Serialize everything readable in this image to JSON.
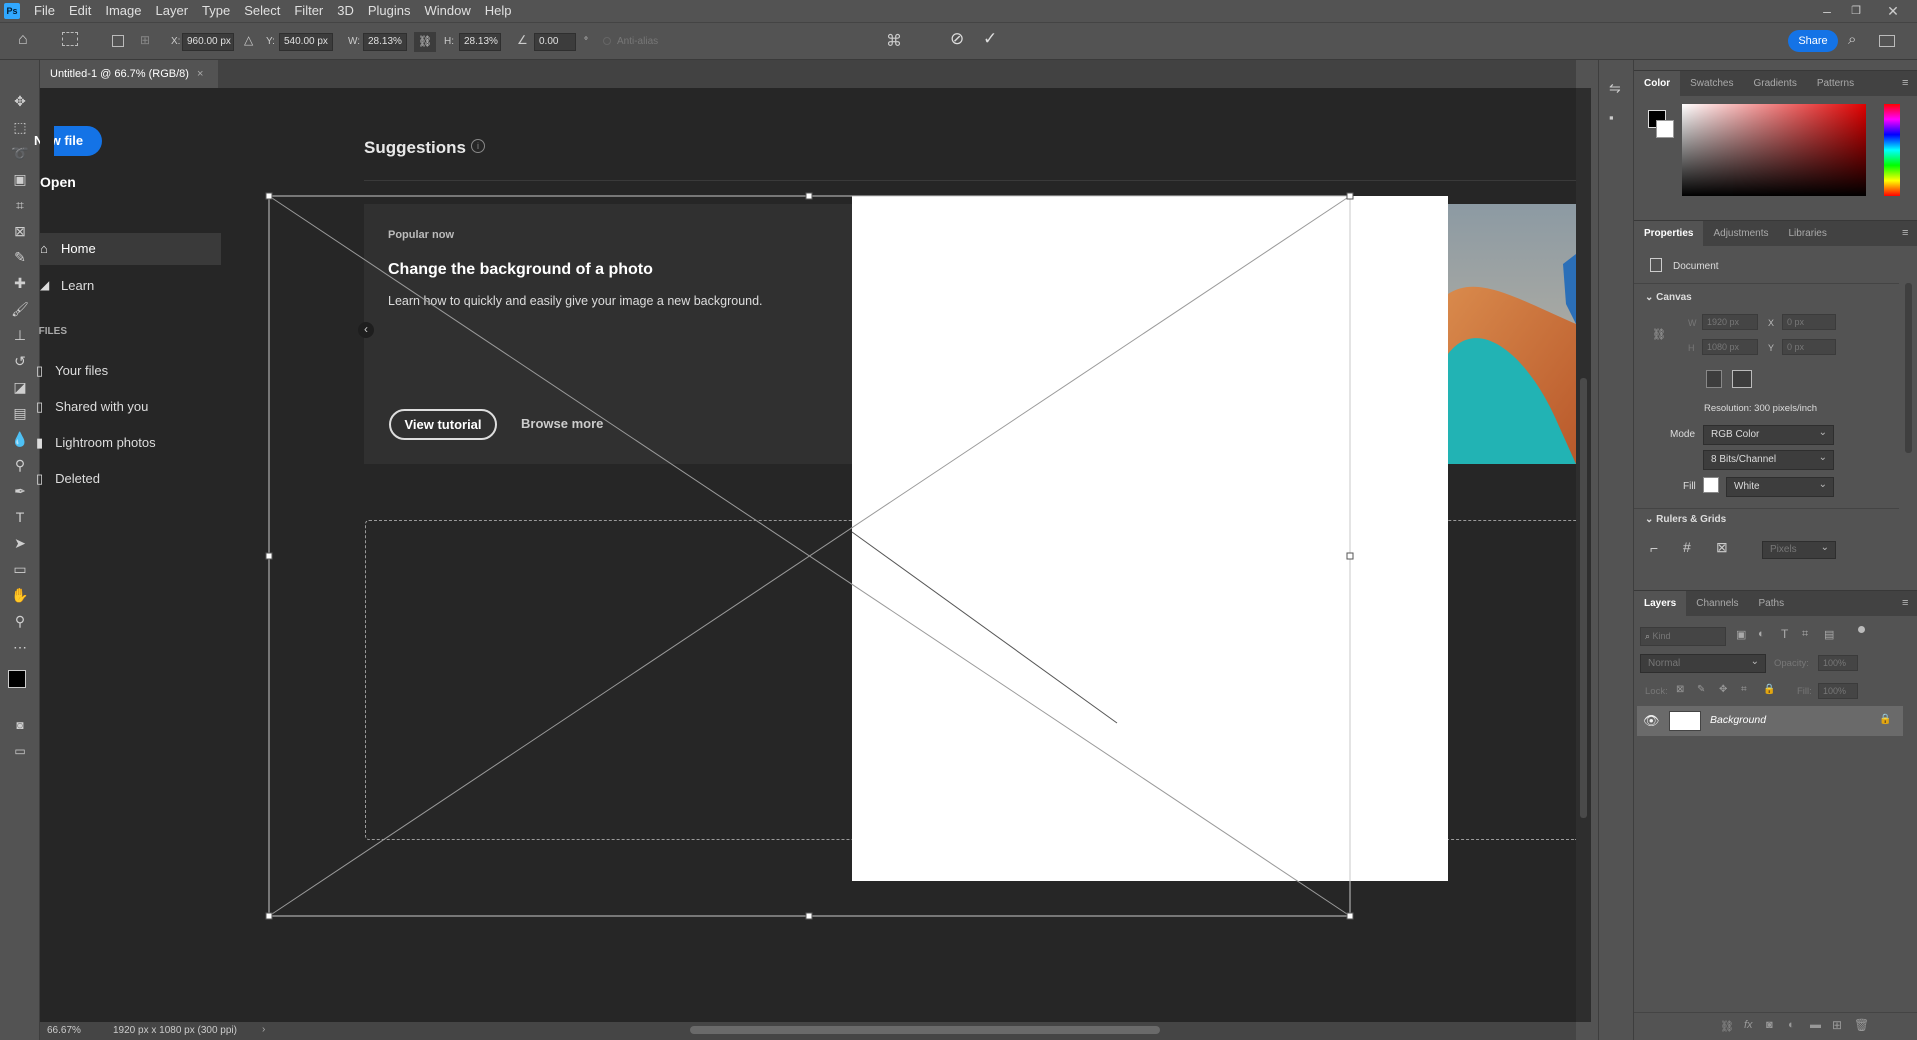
{
  "menubar": {
    "logo": "Ps",
    "items": [
      "File",
      "Edit",
      "Image",
      "Layer",
      "Type",
      "Select",
      "Filter",
      "3D",
      "Plugins",
      "Window",
      "Help"
    ]
  },
  "options": {
    "x_label": "X:",
    "x_value": "960.00 px",
    "y_label": "Y:",
    "y_value": "540.00 px",
    "w_label": "W:",
    "w_value": "28.13%",
    "h_label": "H:",
    "h_value": "28.13%",
    "angle_value": "0.00",
    "deg": "°",
    "antialias_label": "Anti-alias",
    "share_label": "Share"
  },
  "document": {
    "tab_title": "Untitled-1 @ 66.7% (RGB/8)"
  },
  "home": {
    "new_file": "New file",
    "open": "Open",
    "nav": [
      "Home",
      "Learn"
    ],
    "files_heading": "FILES",
    "files": [
      "Your files",
      "Shared with you",
      "Lightroom photos",
      "Deleted"
    ],
    "suggestions_title": "Suggestions",
    "card_eyebrow": "Popular now",
    "card_title": "Change the background of a photo",
    "card_desc": "Learn how to quickly and easily give your image a new background.",
    "view_tutorial": "View tutorial",
    "browse_more": "Browse more"
  },
  "status": {
    "zoom": "66.67%",
    "doc_info": "1920 px x 1080 px (300 ppi)"
  },
  "color_panel": {
    "tabs": [
      "Color",
      "Swatches",
      "Gradients",
      "Patterns"
    ]
  },
  "properties": {
    "tabs": [
      "Properties",
      "Adjustments",
      "Libraries"
    ],
    "doc_label": "Document",
    "canvas_section": "Canvas",
    "w_label": "W",
    "w_value": "1920 px",
    "h_label": "H",
    "h_value": "1080 px",
    "x_label": "X",
    "x_value": "0 px",
    "y_label": "Y",
    "y_value": "0 px",
    "resolution": "Resolution: 300 pixels/inch",
    "mode_label": "Mode",
    "mode_value": "RGB Color",
    "bits_value": "8 Bits/Channel",
    "fill_label": "Fill",
    "fill_value": "White",
    "rulers_section": "Rulers & Grids",
    "units_value": "Pixels"
  },
  "layers": {
    "tabs": [
      "Layers",
      "Channels",
      "Paths"
    ],
    "kind_placeholder": "Kind",
    "blend_mode": "Normal",
    "opacity_label": "Opacity:",
    "opacity_value": "100%",
    "lock_label": "Lock:",
    "fill_label": "Fill:",
    "fill_value": "100%",
    "layer_name": "Background"
  },
  "colors": {
    "accent": "#1473e6",
    "canvas_bg": "#262626",
    "ui_bg": "#535353",
    "transform_line": "#c8c8c8"
  }
}
